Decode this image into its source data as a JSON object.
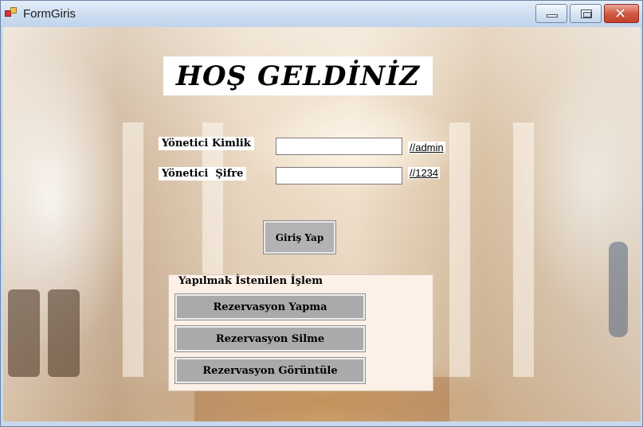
{
  "window": {
    "title": "FormGiris",
    "app_icon": "form-icon",
    "controls": {
      "minimize": "minimize-icon",
      "maximize": "maximize-icon",
      "close": "close-icon"
    },
    "close_glyph": "✕"
  },
  "form": {
    "welcome": "HOŞ GELDİNİZ",
    "admin_id_label": "Yönetici Kimlik",
    "admin_password_label": "Yönetici  Şifre",
    "admin_id_value": "",
    "admin_password_value": "",
    "admin_id_hint": "//admin",
    "admin_password_hint": "//1234",
    "login_button": "Giriş Yap"
  },
  "operations": {
    "title": "Yapılmak İstenilen İşlem",
    "buttons": [
      "Rezervasyon Yapma",
      "Rezervasyon Silme",
      "Rezervasyon Görüntüle"
    ]
  },
  "colors": {
    "button_gray": "#aaaaaa",
    "groupbox_bg": "#fdf0e6",
    "close_red": "#d35a45"
  }
}
